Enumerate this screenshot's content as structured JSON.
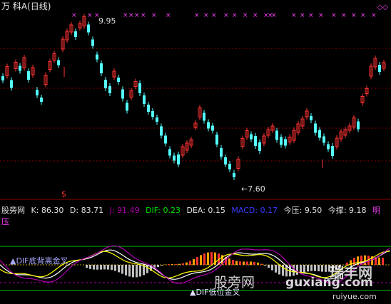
{
  "window": {
    "title": "万  科A(日线)"
  },
  "main_chart": {
    "high_label": "9.95",
    "low_label": "←7.60",
    "dollar_marker": "$",
    "diamonds": "◇◇",
    "colors": {
      "up": "#ff3232",
      "down": "#54ffff",
      "grid": "#8b0000",
      "signal": "#ff44ff"
    }
  },
  "indicator_bar": {
    "name": "股旁网",
    "items": [
      {
        "label": "K",
        "value": "86.30",
        "color": "#e0e0e0"
      },
      {
        "label": "D",
        "value": "83.71",
        "color": "#e0e0e0"
      },
      {
        "label": "J",
        "value": "91.49",
        "color": "#b000b0"
      },
      {
        "label": "DIF",
        "value": "0.23",
        "color": "#00e000"
      },
      {
        "label": "DEA",
        "value": "0.15",
        "color": "#e0e0e0"
      },
      {
        "label": "MACD",
        "value": "0.17",
        "color": "#3a3aff"
      },
      {
        "label": "今压",
        "value": "9.50",
        "color": "#e0e0e0"
      },
      {
        "label": "今撑",
        "value": "9.18",
        "color": "#e0e0e0"
      }
    ],
    "last_label": "明压",
    "last_color": "#ff44ff"
  },
  "sub_chart": {
    "signal_a": "▲DIF底背离金叉",
    "signal_b": "▲DIF低位金叉"
  },
  "watermarks": {
    "w1": "股旁网",
    "w2": "guxiang.com",
    "w3": "瑞丰网",
    "w4": "ruiyue.com"
  }
}
